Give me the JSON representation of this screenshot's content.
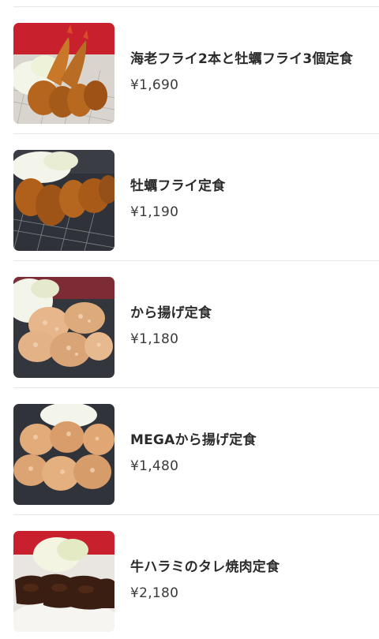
{
  "menu": {
    "items": [
      {
        "name": "海老フライ2本と牡蠣フライ3個定食",
        "price": "¥1,690",
        "image": "fried-shrimp-and-oyster-image"
      },
      {
        "name": "牡蠣フライ定食",
        "price": "¥1,190",
        "image": "fried-oyster-image"
      },
      {
        "name": "から揚げ定食",
        "price": "¥1,180",
        "image": "karaage-image"
      },
      {
        "name": "MEGAから揚げ定食",
        "price": "¥1,480",
        "image": "mega-karaage-image"
      },
      {
        "name": "牛ハラミのタレ焼肉定食",
        "price": "¥2,180",
        "image": "beef-skirt-yakiniku-image"
      }
    ]
  },
  "colors": {
    "text": "#2b2b2b",
    "divider": "#e6e6e6",
    "photo_red_backdrop": "#c8202c",
    "photo_dark_plate": "#2a2d33"
  }
}
